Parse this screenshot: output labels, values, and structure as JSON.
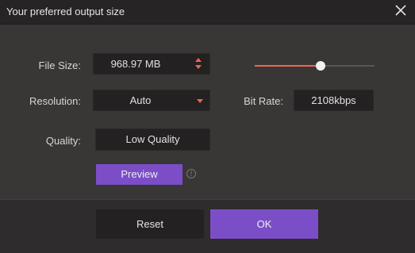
{
  "window": {
    "title": "Your preferred output size"
  },
  "form": {
    "file_size": {
      "label": "File Size:",
      "value": "968.97  MB",
      "slider_level": 0.55
    },
    "resolution": {
      "label": "Resolution:",
      "value": "Auto"
    },
    "bit_rate": {
      "label": "Bit Rate:",
      "value": "2108kbps"
    },
    "quality": {
      "label": "Quality:",
      "value": "Low Quality"
    }
  },
  "buttons": {
    "preview": "Preview",
    "reset": "Reset",
    "ok": "OK"
  },
  "icons": {
    "close": "close-icon",
    "info": "info-icon",
    "stepper": "stepper-arrows-icon",
    "dropdown": "dropdown-caret-icon"
  },
  "colors": {
    "accent": "#7b4ec8",
    "slider": "#f0644d"
  }
}
